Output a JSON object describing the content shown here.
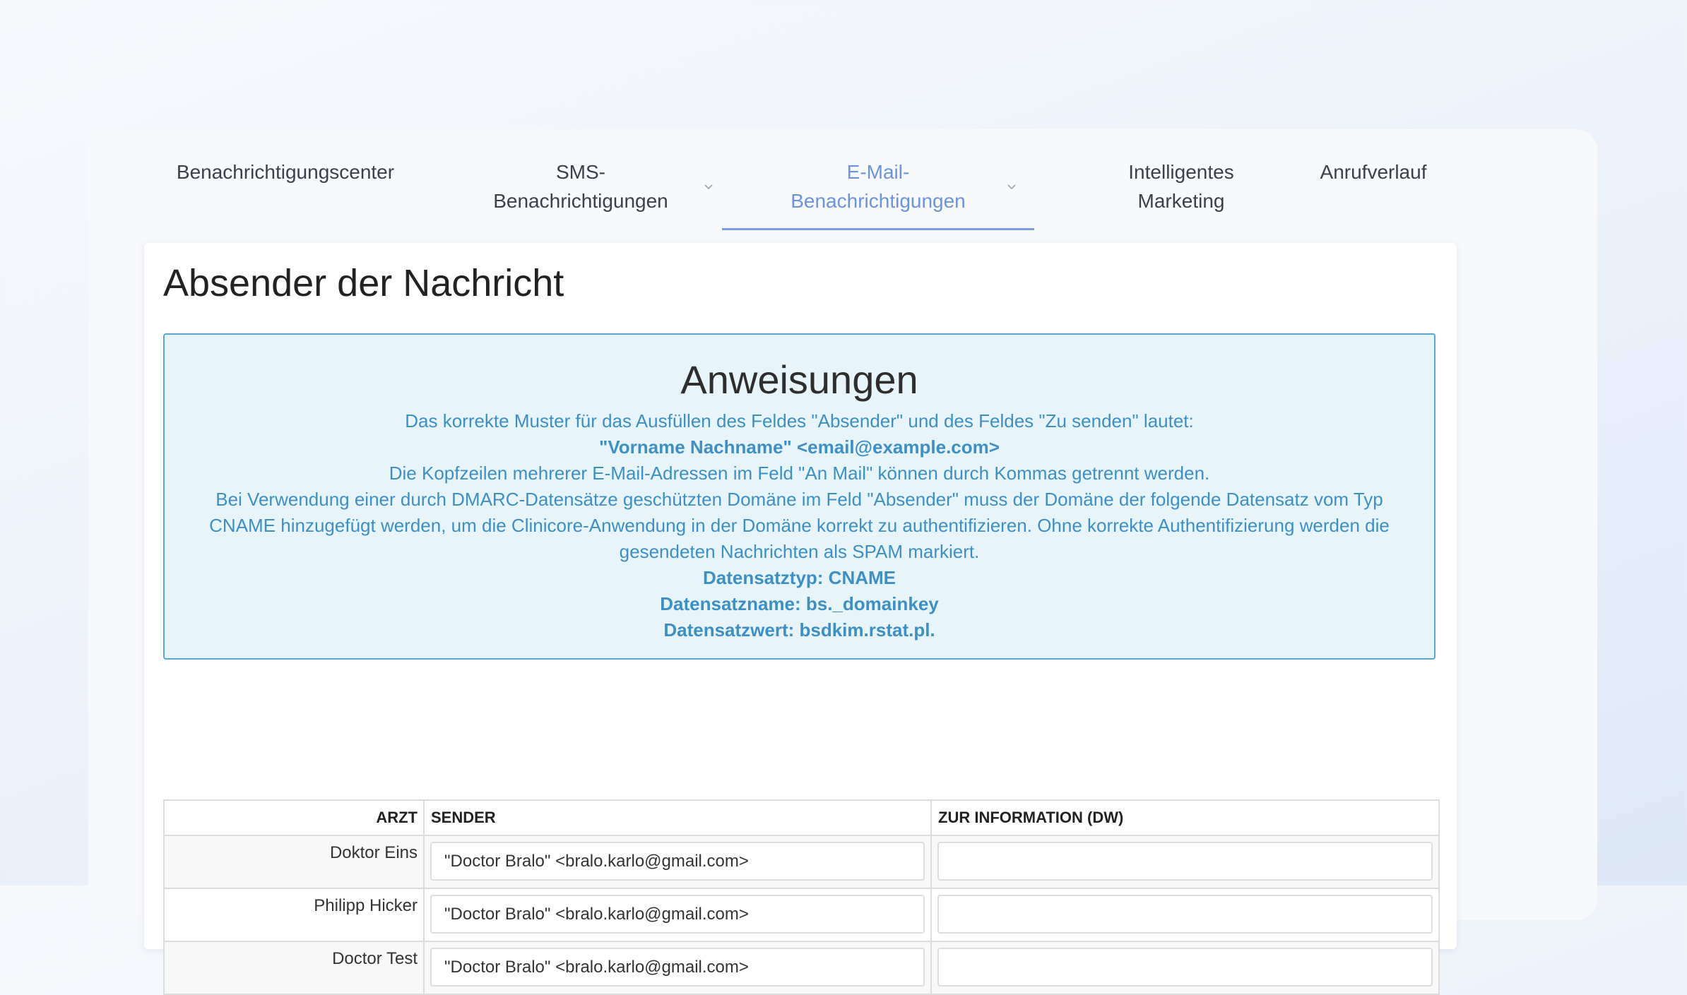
{
  "nav": {
    "tabs": [
      {
        "line1": "Benachrichtigungscenter",
        "line2": ""
      },
      {
        "line1": "SMS-",
        "line2": "Benachrichtigungen"
      },
      {
        "line1": "E-Mail-",
        "line2": "Benachrichtigungen"
      },
      {
        "line1": "Intelligentes",
        "line2": "Marketing"
      },
      {
        "line1": "Anrufverlauf",
        "line2": ""
      }
    ],
    "active_tab": "E-Mail-Benachrichtigungen",
    "icons": [
      "chevron-down-icon"
    ]
  },
  "card": {
    "title": "Absender der Nachricht"
  },
  "instructions": {
    "title": "Anweisungen",
    "lines": [
      "Das korrekte Muster für das Ausfüllen des Feldes \"Absender\" und des Feldes \"Zu senden\" lautet:",
      "\"Vorname Nachname\" <email@example.com>",
      "Die Kopfzeilen mehrerer E-Mail-Adressen im Feld \"An Mail\" können durch Kommas getrennt werden.",
      "Bei Verwendung einer durch DMARC-Datensätze geschützten Domäne im Feld \"Absender\" muss der Domäne der folgende Datensatz vom Typ CNAME hinzugefügt werden, um die Clinicore-Anwendung in der Domäne korrekt zu authentifizieren. Ohne korrekte Authentifizierung werden die gesendeten Nachrichten als SPAM markiert.",
      "Datensatztyp: CNAME",
      "Datensatzname: bs._domainkey",
      "Datensatzwert: bsdkim.rstat.pl."
    ]
  },
  "table": {
    "headers": {
      "doctor": "ARZT",
      "sender": "SENDER",
      "cc": "ZUR INFORMATION (DW)"
    },
    "rows": [
      {
        "doctor": "Doktor Eins",
        "sender": "\"Doctor Bralo\" <bralo.karlo@gmail.com>",
        "cc": ""
      },
      {
        "doctor": "Philipp Hicker",
        "sender": "\"Doctor Bralo\" <bralo.karlo@gmail.com>",
        "cc": ""
      },
      {
        "doctor": "Doctor Test",
        "sender": "\"Doctor Bralo\" <bralo.karlo@gmail.com>",
        "cc": ""
      }
    ]
  },
  "colors": {
    "accent": "#6b93de",
    "info_border": "#5aa6d1",
    "info_background": "#e7f5fb",
    "info_text": "#3d8fc4"
  }
}
